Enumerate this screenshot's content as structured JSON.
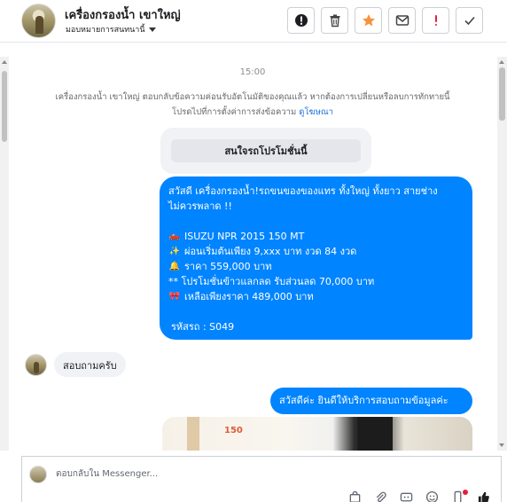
{
  "header": {
    "title": "เครื่องกรองน้ำ เขาใหญ่",
    "assign_label": "มอบหมายการสนทนานี้",
    "actions": [
      {
        "name": "spam-button",
        "icon": "alert-circle-icon"
      },
      {
        "name": "delete-button",
        "icon": "trash-icon"
      },
      {
        "name": "star-button",
        "icon": "star-icon"
      },
      {
        "name": "unread-button",
        "icon": "envelope-icon"
      },
      {
        "name": "follow-up-button",
        "icon": "exclamation-icon"
      },
      {
        "name": "done-button",
        "icon": "check-icon"
      }
    ],
    "colors": {
      "star": "#f7923b",
      "follow_up": "#e41e3f"
    }
  },
  "conversation": {
    "timestamp": "15:00",
    "system_notice_line1": "เครื่องกรองน้ำ เขาใหญ่ ตอบกลับข้อความค่อนรับอัตโนมัติของคุณแล้ว หากต้องการเปลี่ยนหรือลบการทักทายนี้",
    "system_notice_line2": "โปรดไปที่การตั้งค่าการส่งข้อความ",
    "system_notice_link": "ดูโฆษณา",
    "card_button": "สนใจรถโปรโมชั่นนี้",
    "outgoing_1": {
      "line1": "สวัสดี เครื่องกรองน้ำ!รถขนของของแทร ทั้งใหญ่ ทั้งยาว สายช่าง",
      "line2": "ไม่ควรพลาด !!",
      "items": [
        {
          "emoji": "🛻",
          "text": "ISUZU NPR 2015 150 MT"
        },
        {
          "emoji": "✨",
          "text": "ผ่อนเริ่มต้นเพียง 9,xxx บาท งวด 84 งวด"
        },
        {
          "emoji": "🔔",
          "text": "ราคา 559,000 บาท"
        },
        {
          "emoji": "",
          "text": "** โปรโมชั่นข้าวแลกลด รับส่วนลด 70,000 บาท"
        },
        {
          "emoji": "🎀",
          "text": "เหลือเพียงราคา 489,000 บาท"
        }
      ],
      "code": "รหัสรถ : S049"
    },
    "incoming_1": "สอบถามครับ",
    "outgoing_2": "สวัสดีค่ะ  ยินดีให้บริการสอบถามข้อมูลค่ะ",
    "image_caption": "150",
    "colors": {
      "outgoing_bubble": "#0084ff",
      "incoming_bubble": "#f0f2f5"
    }
  },
  "composer": {
    "placeholder": "ตอบกลับใน Messenger...",
    "tools": [
      "shopping-bag-icon",
      "paperclip-icon",
      "gif-icon",
      "emoji-icon",
      "phone-icon",
      "like-icon"
    ]
  }
}
